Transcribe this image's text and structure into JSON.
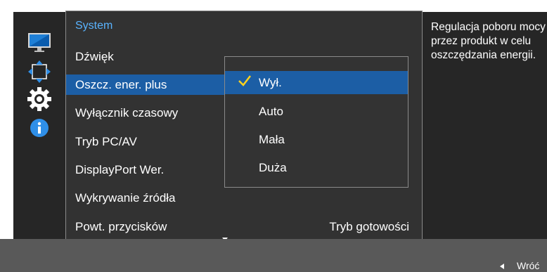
{
  "sidebar": {
    "icons": [
      "monitor-icon",
      "move-arrows-icon",
      "gear-icon",
      "info-icon"
    ]
  },
  "menu": {
    "title": "System",
    "items": [
      {
        "label": "Dźwięk",
        "value": ""
      },
      {
        "label": "Oszcz. ener. plus",
        "value": ""
      },
      {
        "label": "Wyłącznik czasowy",
        "value": ""
      },
      {
        "label": "Tryb PC/AV",
        "value": ""
      },
      {
        "label": "DisplayPort Wer.",
        "value": ""
      },
      {
        "label": "Wykrywanie źródła",
        "value": ""
      },
      {
        "label": "Powt. przycisków",
        "value": "Tryb gotowości"
      }
    ],
    "selected_index": 1
  },
  "dropdown": {
    "options": [
      "Wył.",
      "Auto",
      "Mała",
      "Duża"
    ],
    "selected_index": 0
  },
  "description": {
    "text": "Regulacja poboru mocy przez produkt w celu oszczędzania energii."
  },
  "footer": {
    "back_label": "Wróć"
  },
  "colors": {
    "accent": "#1c5ea5",
    "title": "#59b3ff",
    "check": "#ffd21f"
  }
}
